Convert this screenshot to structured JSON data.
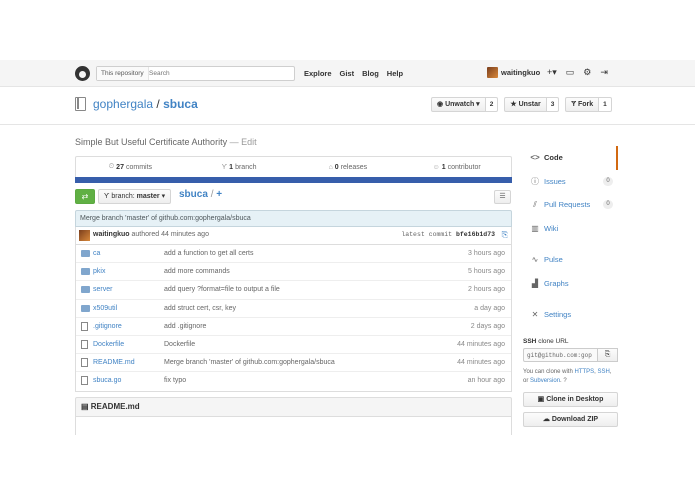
{
  "header": {
    "search_scope": "This repository",
    "search_placeholder": "Search",
    "nav": [
      "Explore",
      "Gist",
      "Blog",
      "Help"
    ],
    "username": "waitingkuo",
    "icons": [
      "plus-icon",
      "inbox-icon",
      "gear-icon",
      "sign-out-icon"
    ]
  },
  "repo": {
    "owner": "gophergala",
    "separator": "/",
    "name": "sbuca",
    "unwatch_label": "Unwatch",
    "watch_count": "2",
    "unstar_label": "Unstar",
    "star_count": "3",
    "fork_label": "Fork",
    "fork_count": "1",
    "description": "Simple But Useful Certificate Authority",
    "edit_label": "— Edit"
  },
  "stats": {
    "commits_n": "27",
    "commits_label": "commits",
    "branch_n": "1",
    "branch_label": "branch",
    "releases_n": "0",
    "releases_label": "releases",
    "contributor_n": "1",
    "contributor_label": "contributor"
  },
  "filenav": {
    "branch_prefix": "branch:",
    "branch_name": "master",
    "crumb_repo": "sbuca",
    "crumb_sep": "/",
    "crumb_add": "+"
  },
  "commit": {
    "message": "Merge branch 'master' of github.com:gophergala/sbuca",
    "author": "waitingkuo",
    "authored_text": "authored 44 minutes ago",
    "latest_label": "latest commit",
    "sha": "bfe16b1d73"
  },
  "files": [
    {
      "type": "dir",
      "name": "ca",
      "message": "add a function to get all certs",
      "age": "3 hours ago"
    },
    {
      "type": "dir",
      "name": "pkix",
      "message": "add more commands",
      "age": "5 hours ago"
    },
    {
      "type": "dir",
      "name": "server",
      "message": "add query ?format=file to output a file",
      "age": "2 hours ago"
    },
    {
      "type": "dir",
      "name": "x509util",
      "message": "add struct cert, csr, key",
      "age": "a day ago"
    },
    {
      "type": "file",
      "name": ".gitignore",
      "message": "add .gitignore",
      "age": "2 days ago"
    },
    {
      "type": "file",
      "name": "Dockerfile",
      "message": "Dockerfile",
      "age": "44 minutes ago"
    },
    {
      "type": "file",
      "name": "README.md",
      "message": "Merge branch 'master' of github.com:gophergala/sbuca",
      "age": "44 minutes ago"
    },
    {
      "type": "file",
      "name": "sbuca.go",
      "message": "fix typo",
      "age": "an hour ago"
    }
  ],
  "readme": {
    "title": "README.md"
  },
  "sidebar": {
    "code": "Code",
    "issues": "Issues",
    "issues_count": "0",
    "pulls": "Pull Requests",
    "pulls_count": "0",
    "wiki": "Wiki",
    "pulse": "Pulse",
    "graphs": "Graphs",
    "settings": "Settings",
    "ssh_label": "SSH",
    "clone_url_label": "clone URL",
    "ssh_value": "git@github.com:gop",
    "clone_note_prefix": "You can clone with",
    "https_link": "HTTPS",
    "ssh_link": "SSH",
    "or_text": ", or",
    "subversion_link": "Subversion",
    "clone_desktop": "Clone in Desktop",
    "download_zip": "Download ZIP"
  }
}
